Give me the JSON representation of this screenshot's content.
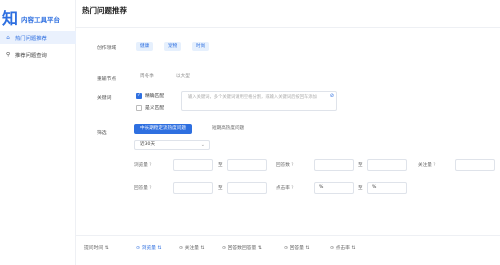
{
  "brand": {
    "logo": "知",
    "name": "内容工具平台"
  },
  "sidebar": {
    "items": [
      {
        "icon": "home-icon",
        "glyph": "⌂",
        "label": "热门问题推荐"
      },
      {
        "icon": "search-icon",
        "glyph": "⚲",
        "label": "推荐问题查询"
      }
    ]
  },
  "header": {
    "title": "热门问题推荐"
  },
  "form": {
    "domain": {
      "label": "创作领域",
      "tags": [
        "健康",
        "宠物",
        "时尚"
      ]
    },
    "season": {
      "label": "重输节点",
      "options": [
        "周冬季",
        "以大型"
      ]
    },
    "keyword": {
      "label": "关键词",
      "checks": [
        "精确匹配",
        "是义匹配"
      ],
      "placeholder": "输入关键词，多个关键词请用空格分割，或输入关键词后按回车添加"
    },
    "filter": {
      "label": "筛选",
      "segments": [
        "中长期稳定流热度问题",
        "短期高热度问题"
      ],
      "select": "近30天"
    },
    "ranges": {
      "row1": [
        "浏览量",
        "回答数",
        "关注量"
      ],
      "row2": [
        "回答量",
        "点击率"
      ],
      "to": "至",
      "percent": "%"
    }
  },
  "sortbar": {
    "items": [
      "提问时间",
      "浏览量",
      "关注量",
      "回答数回答量",
      "回答量",
      "点击率"
    ]
  },
  "colors": {
    "accent": "#2e6fe0"
  }
}
